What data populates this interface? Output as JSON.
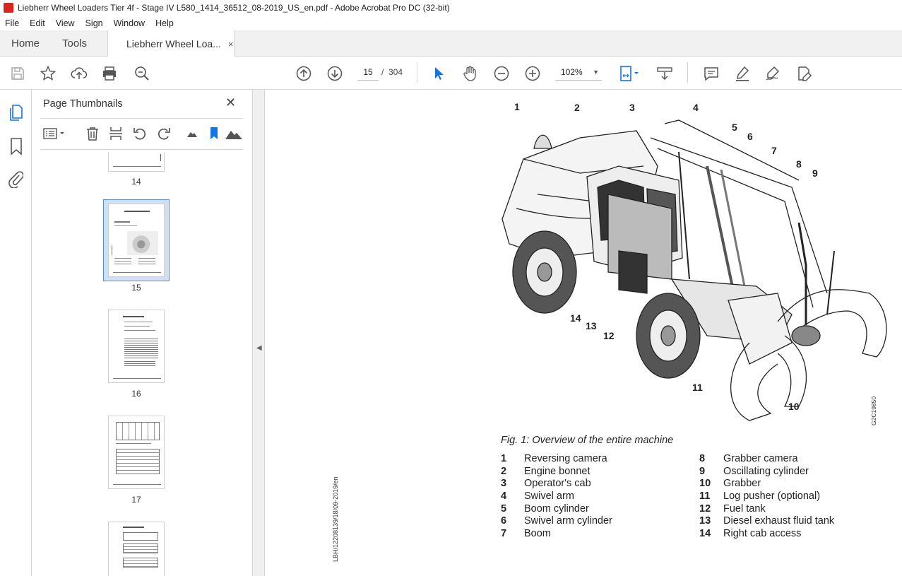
{
  "window": {
    "title": "Liebherr Wheel Loaders Tier 4f - Stage IV L580_1414_36512_08-2019_US_en.pdf - Adobe Acrobat Pro DC (32-bit)"
  },
  "menu": [
    "File",
    "Edit",
    "View",
    "Sign",
    "Window",
    "Help"
  ],
  "tabs": {
    "home": "Home",
    "tools": "Tools",
    "document": "Liebherr Wheel Loa...",
    "close": "×"
  },
  "toolbar": {
    "page_current": "15",
    "page_sep": "/",
    "page_total": "304",
    "zoom": "102%",
    "icons": [
      "save-icon",
      "bookmark-star-icon",
      "upload-icon",
      "print-icon",
      "search-zoom-icon",
      "prev-page-icon",
      "next-page-icon",
      "select-arrow-icon",
      "hand-icon",
      "zoom-out-icon",
      "zoom-in-icon",
      "fit-page-icon",
      "scroll-mode-icon",
      "comment-icon",
      "highlight-icon",
      "sign-icon",
      "edit-icon"
    ]
  },
  "panel": {
    "title": "Page Thumbnails",
    "close": "✕",
    "thumbnails": [
      {
        "label": "14"
      },
      {
        "label": "15",
        "selected": true
      },
      {
        "label": "16"
      },
      {
        "label": "17"
      }
    ]
  },
  "document": {
    "figure_caption": "Fig. 1: Overview of the entire machine",
    "side_code": "LBH/12208139/18/09-2019/en",
    "figure_code": "G2C19850",
    "callouts": [
      "1",
      "2",
      "3",
      "4",
      "5",
      "6",
      "7",
      "8",
      "9",
      "10",
      "11",
      "12",
      "13",
      "14"
    ],
    "legend_left": [
      {
        "n": "1",
        "t": "Reversing camera"
      },
      {
        "n": "2",
        "t": "Engine bonnet"
      },
      {
        "n": "3",
        "t": "Operator's cab"
      },
      {
        "n": "4",
        "t": "Swivel arm"
      },
      {
        "n": "5",
        "t": "Boom cylinder"
      },
      {
        "n": "6",
        "t": "Swivel arm cylinder"
      },
      {
        "n": "7",
        "t": "Boom"
      }
    ],
    "legend_right": [
      {
        "n": "8",
        "t": "Grabber camera"
      },
      {
        "n": "9",
        "t": "Oscillating cylinder"
      },
      {
        "n": "10",
        "t": "Grabber"
      },
      {
        "n": "11",
        "t": "Log pusher (optional)"
      },
      {
        "n": "12",
        "t": "Fuel tank"
      },
      {
        "n": "13",
        "t": "Diesel exhaust fluid tank"
      },
      {
        "n": "14",
        "t": "Right cab access"
      }
    ]
  },
  "colors": {
    "accent": "#1473e6",
    "pdf_red": "#d7261e"
  }
}
